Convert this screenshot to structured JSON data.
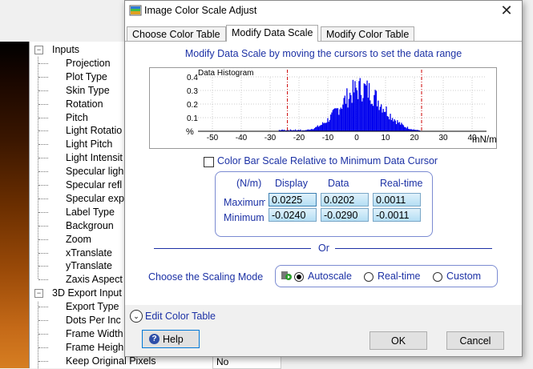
{
  "background": {
    "tree_nodes": [
      {
        "label": "Inputs",
        "level": 0,
        "expander": "⊟"
      },
      {
        "label": "Projection",
        "level": 1
      },
      {
        "label": "Plot Type",
        "level": 1
      },
      {
        "label": "Skin Type",
        "level": 1
      },
      {
        "label": "Rotation",
        "level": 1
      },
      {
        "label": "Pitch",
        "level": 1
      },
      {
        "label": "Light Rotatio",
        "level": 1
      },
      {
        "label": "Light Pitch",
        "level": 1
      },
      {
        "label": "Light Intensit",
        "level": 1
      },
      {
        "label": "Specular ligh",
        "level": 1
      },
      {
        "label": "Specular refl",
        "level": 1
      },
      {
        "label": "Specular exp",
        "level": 1
      },
      {
        "label": "Label Type",
        "level": 1
      },
      {
        "label": "Backgroun",
        "level": 1
      },
      {
        "label": "Zoom",
        "level": 1
      },
      {
        "label": "xTranslate",
        "level": 1
      },
      {
        "label": "yTranslate",
        "level": 1
      },
      {
        "label": "Zaxis Aspect",
        "level": 1
      },
      {
        "label": "3D Export Input",
        "level": 0,
        "expander": "⊟"
      },
      {
        "label": "Export Type",
        "level": 1
      },
      {
        "label": "Dots Per Inc",
        "level": 1
      },
      {
        "label": "Frame Width",
        "level": 1
      },
      {
        "label": "Frame Heigh",
        "level": 1
      },
      {
        "label": "Keep Original Pixels",
        "level": 1
      }
    ],
    "keep_pixels_value": "No"
  },
  "dialog": {
    "title": "Image Color Scale Adjust",
    "close_glyph": "✕",
    "tabs": [
      {
        "label": "Choose Color Table",
        "active": false
      },
      {
        "label": "Modify Data Scale",
        "active": true
      },
      {
        "label": "Modify Color Table",
        "active": false
      }
    ],
    "heading": "Modify Data Scale by moving the cursors to set the data range",
    "histogram": {
      "title": "Data Histogram",
      "y_ticks": [
        "0.4",
        "0.3",
        "0.2",
        "0.1"
      ],
      "y_label": "%",
      "x_ticks": [
        "-50",
        "-40",
        "-30",
        "-20",
        "-10",
        "0",
        "10",
        "20",
        "30",
        "40"
      ],
      "x_label": "mN/m",
      "cursor_min": -24.0,
      "cursor_max": 22.5,
      "bar_color": "#0000ee",
      "cursor_color": "#cc0000"
    },
    "relative_checkbox_label": "Color Bar Scale Relative to Minimum Data Cursor",
    "relative_checked": false,
    "scale_table": {
      "unit_header": "(N/m)",
      "col_headers": [
        "Display",
        "Data",
        "Real-time"
      ],
      "rows": [
        {
          "label": "Maximum",
          "values": [
            "0.0225",
            "0.0202",
            "0.0011"
          ]
        },
        {
          "label": "Minimum",
          "values": [
            "-0.0240",
            "-0.0290",
            "-0.0011"
          ]
        }
      ]
    },
    "or_text": "Or",
    "scaling_label": "Choose the Scaling Mode",
    "scaling_options": [
      {
        "label": "Autoscale",
        "selected": true
      },
      {
        "label": "Real-time",
        "selected": false
      },
      {
        "label": "Custom",
        "selected": false
      }
    ],
    "edit_color_table_label": "Edit Color Table",
    "help_label": "Help",
    "ok_label": "OK",
    "cancel_label": "Cancel"
  }
}
